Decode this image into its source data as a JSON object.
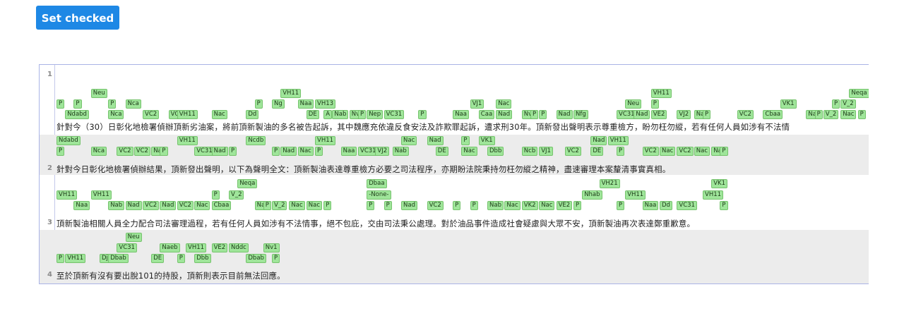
{
  "toolbar": {
    "set_checked_label": "Set checked"
  },
  "editor": {
    "lines": [
      {
        "number": "1",
        "text": "針對今（30）日彰化地檢署偵辦頂新劣油案，將前頂新製油的多名被告起訴，其中魏應充依違反食安法及詐欺罪起訴，遭求刑30年。頂新發出聲明表示尊重檢方，盼勿枉勿縱，若有任何人員如涉有不法情",
        "tags": [
          {
            "t": "Neu",
            "r": 0,
            "c": 4
          },
          {
            "t": "VH11",
            "r": 0,
            "c": 26
          },
          {
            "t": "VH11",
            "r": 0,
            "c": 69
          },
          {
            "t": "Neqa",
            "r": 0,
            "c": 92
          },
          {
            "t": "P",
            "r": 1,
            "c": 0
          },
          {
            "t": "P",
            "r": 1,
            "c": 2
          },
          {
            "t": "P",
            "r": 1,
            "c": 6
          },
          {
            "t": "Nca",
            "r": 1,
            "c": 8
          },
          {
            "t": "P",
            "r": 1,
            "c": 23
          },
          {
            "t": "Ng",
            "r": 1,
            "c": 25
          },
          {
            "t": "Naa",
            "r": 1,
            "c": 28
          },
          {
            "t": "VH13",
            "r": 1,
            "c": 30
          },
          {
            "t": "VJ1",
            "r": 1,
            "c": 48
          },
          {
            "t": "Nac",
            "r": 1,
            "c": 51
          },
          {
            "t": "Neu",
            "r": 1,
            "c": 66
          },
          {
            "t": "P",
            "r": 1,
            "c": 69
          },
          {
            "t": "VK1",
            "r": 1,
            "c": 84
          },
          {
            "t": "P",
            "r": 1,
            "c": 90
          },
          {
            "t": "V_2",
            "r": 1,
            "c": 91
          },
          {
            "t": "Ndabd",
            "r": 2,
            "c": 1
          },
          {
            "t": "Nca",
            "r": 2,
            "c": 6
          },
          {
            "t": "VC2",
            "r": 2,
            "c": 10
          },
          {
            "t": "VC2",
            "r": 2,
            "c": 13
          },
          {
            "t": "VH11",
            "r": 2,
            "c": 14
          },
          {
            "t": "Nac",
            "r": 2,
            "c": 18
          },
          {
            "t": "Dd",
            "r": 2,
            "c": 22
          },
          {
            "t": "DE",
            "r": 2,
            "c": 29
          },
          {
            "t": "A",
            "r": 2,
            "c": 31
          },
          {
            "t": "Nab",
            "r": 2,
            "c": 32
          },
          {
            "t": "Nv1",
            "r": 2,
            "c": 34
          },
          {
            "t": "P",
            "r": 2,
            "c": 35
          },
          {
            "t": "Nep",
            "r": 2,
            "c": 36
          },
          {
            "t": "VC31",
            "r": 2,
            "c": 38
          },
          {
            "t": "P",
            "r": 2,
            "c": 42
          },
          {
            "t": "Naa",
            "r": 2,
            "c": 46
          },
          {
            "t": "Caa",
            "r": 2,
            "c": 49
          },
          {
            "t": "Nad",
            "r": 2,
            "c": 51
          },
          {
            "t": "Nv1",
            "r": 2,
            "c": 54
          },
          {
            "t": "P",
            "r": 2,
            "c": 55
          },
          {
            "t": "P",
            "r": 2,
            "c": 56
          },
          {
            "t": "Nad",
            "r": 2,
            "c": 58
          },
          {
            "t": "Nfg",
            "r": 2,
            "c": 60
          },
          {
            "t": "VC31",
            "r": 2,
            "c": 65
          },
          {
            "t": "Nad",
            "r": 2,
            "c": 67
          },
          {
            "t": "VE2",
            "r": 2,
            "c": 69
          },
          {
            "t": "VJ2",
            "r": 2,
            "c": 72
          },
          {
            "t": "Nab",
            "r": 2,
            "c": 74
          },
          {
            "t": "P",
            "r": 2,
            "c": 75
          },
          {
            "t": "VC2",
            "r": 2,
            "c": 79
          },
          {
            "t": "Cbaa",
            "r": 2,
            "c": 82
          },
          {
            "t": "Nab",
            "r": 2,
            "c": 87
          },
          {
            "t": "P",
            "r": 2,
            "c": 88
          },
          {
            "t": "V_2",
            "r": 2,
            "c": 89
          },
          {
            "t": "Nac",
            "r": 2,
            "c": 91
          },
          {
            "t": "P",
            "r": 2,
            "c": 93
          }
        ]
      },
      {
        "number": "2",
        "text": "針對今日彰化地檢署偵辦結果，頂新發出聲明，以下為聲明全文：頂新製油表達尊重檢方必要之司法程序，亦期盼法院秉持勿枉勿縱之精神，盡速審理本案釐清事實真相。",
        "tags": [
          {
            "t": "Ndabd",
            "r": 0,
            "c": 0
          },
          {
            "t": "VH11",
            "r": 0,
            "c": 14
          },
          {
            "t": "Ncdb",
            "r": 0,
            "c": 22
          },
          {
            "t": "VH11",
            "r": 0,
            "c": 30
          },
          {
            "t": "Nac",
            "r": 0,
            "c": 40
          },
          {
            "t": "Nad",
            "r": 0,
            "c": 43
          },
          {
            "t": "P",
            "r": 0,
            "c": 47
          },
          {
            "t": "VK1",
            "r": 0,
            "c": 49
          },
          {
            "t": "Nad",
            "r": 0,
            "c": 62
          },
          {
            "t": "VH11",
            "r": 0,
            "c": 64
          },
          {
            "t": "P",
            "r": 1,
            "c": 0
          },
          {
            "t": "Nca",
            "r": 1,
            "c": 4
          },
          {
            "t": "VC2",
            "r": 1,
            "c": 7
          },
          {
            "t": "VC2",
            "r": 1,
            "c": 9
          },
          {
            "t": "Nac",
            "r": 1,
            "c": 11
          },
          {
            "t": "P",
            "r": 1,
            "c": 12
          },
          {
            "t": "VC31",
            "r": 1,
            "c": 16
          },
          {
            "t": "Nad",
            "r": 1,
            "c": 18
          },
          {
            "t": "P",
            "r": 1,
            "c": 20
          },
          {
            "t": "P",
            "r": 1,
            "c": 25
          },
          {
            "t": "Nad",
            "r": 1,
            "c": 26
          },
          {
            "t": "Nac",
            "r": 1,
            "c": 28
          },
          {
            "t": "P",
            "r": 1,
            "c": 30
          },
          {
            "t": "Naa",
            "r": 1,
            "c": 33
          },
          {
            "t": "VC31",
            "r": 1,
            "c": 35
          },
          {
            "t": "VJ2",
            "r": 1,
            "c": 37
          },
          {
            "t": "Nab",
            "r": 1,
            "c": 39
          },
          {
            "t": "DE",
            "r": 1,
            "c": 44
          },
          {
            "t": "Nac",
            "r": 1,
            "c": 47
          },
          {
            "t": "Dbb",
            "r": 1,
            "c": 50
          },
          {
            "t": "Ncb",
            "r": 1,
            "c": 54
          },
          {
            "t": "VJ1",
            "r": 1,
            "c": 56
          },
          {
            "t": "VC2",
            "r": 1,
            "c": 59
          },
          {
            "t": "DE",
            "r": 1,
            "c": 62
          },
          {
            "t": "P",
            "r": 1,
            "c": 65
          },
          {
            "t": "VC2",
            "r": 1,
            "c": 68
          },
          {
            "t": "Nac",
            "r": 1,
            "c": 70
          },
          {
            "t": "VC2",
            "r": 1,
            "c": 72
          },
          {
            "t": "Nac",
            "r": 1,
            "c": 74
          },
          {
            "t": "Nac",
            "r": 1,
            "c": 76
          },
          {
            "t": "P",
            "r": 1,
            "c": 77
          }
        ]
      },
      {
        "number": "3",
        "text": "頂新製油相關人員全力配合司法審理過程，若有任何人員如涉有不法情事，絕不包庇，交由司法秉公處理。對於油品事件造成社會疑慮與大眾不安，頂新製油再次表達鄭重歉意。",
        "tags": [
          {
            "t": "Neqa",
            "r": 0,
            "c": 21
          },
          {
            "t": "Dbaa",
            "r": 0,
            "c": 36
          },
          {
            "t": "VH21",
            "r": 0,
            "c": 63
          },
          {
            "t": "VK1",
            "r": 0,
            "c": 76
          },
          {
            "t": "VH11",
            "r": 1,
            "c": 0
          },
          {
            "t": "VH11",
            "r": 1,
            "c": 4
          },
          {
            "t": "P",
            "r": 1,
            "c": 18
          },
          {
            "t": "V_2",
            "r": 1,
            "c": 20
          },
          {
            "t": "-None-",
            "r": 1,
            "c": 36
          },
          {
            "t": "Nhab",
            "r": 1,
            "c": 61
          },
          {
            "t": "VH11",
            "r": 1,
            "c": 66
          },
          {
            "t": "VH11",
            "r": 1,
            "c": 75
          },
          {
            "t": "Naa",
            "r": 2,
            "c": 2
          },
          {
            "t": "Nab",
            "r": 2,
            "c": 6
          },
          {
            "t": "Nad",
            "r": 2,
            "c": 8
          },
          {
            "t": "VC2",
            "r": 2,
            "c": 10
          },
          {
            "t": "Nad",
            "r": 2,
            "c": 12
          },
          {
            "t": "VC2",
            "r": 2,
            "c": 14
          },
          {
            "t": "Nac",
            "r": 2,
            "c": 16
          },
          {
            "t": "Cbaa",
            "r": 2,
            "c": 18
          },
          {
            "t": "Nab",
            "r": 2,
            "c": 23
          },
          {
            "t": "P",
            "r": 2,
            "c": 24
          },
          {
            "t": "V_2",
            "r": 2,
            "c": 25
          },
          {
            "t": "Nac",
            "r": 2,
            "c": 27
          },
          {
            "t": "Nac",
            "r": 2,
            "c": 29
          },
          {
            "t": "P",
            "r": 2,
            "c": 31
          },
          {
            "t": "P",
            "r": 2,
            "c": 36
          },
          {
            "t": "P",
            "r": 2,
            "c": 38
          },
          {
            "t": "Nad",
            "r": 2,
            "c": 40
          },
          {
            "t": "VC2",
            "r": 2,
            "c": 43
          },
          {
            "t": "P",
            "r": 2,
            "c": 46
          },
          {
            "t": "P",
            "r": 2,
            "c": 48
          },
          {
            "t": "Nab",
            "r": 2,
            "c": 50
          },
          {
            "t": "Nac",
            "r": 2,
            "c": 52
          },
          {
            "t": "VK2",
            "r": 2,
            "c": 54
          },
          {
            "t": "Nac",
            "r": 2,
            "c": 56
          },
          {
            "t": "VE2",
            "r": 2,
            "c": 58
          },
          {
            "t": "P",
            "r": 2,
            "c": 60
          },
          {
            "t": "P",
            "r": 2,
            "c": 65
          },
          {
            "t": "Naa",
            "r": 2,
            "c": 68
          },
          {
            "t": "Dd",
            "r": 2,
            "c": 70
          },
          {
            "t": "VC31",
            "r": 2,
            "c": 72
          },
          {
            "t": "P",
            "r": 2,
            "c": 77
          }
        ]
      },
      {
        "number": "4",
        "text": "至於頂新有沒有要出脫101的持股，頂新則表示目前無法回應。",
        "tags": [
          {
            "t": "Neu",
            "r": 0,
            "c": 8
          },
          {
            "t": "VC31",
            "r": 1,
            "c": 7
          },
          {
            "t": "Naeb",
            "r": 1,
            "c": 12
          },
          {
            "t": "VH11",
            "r": 1,
            "c": 15
          },
          {
            "t": "VE2",
            "r": 1,
            "c": 18
          },
          {
            "t": "Nddc",
            "r": 1,
            "c": 20
          },
          {
            "t": "Nv1",
            "r": 1,
            "c": 24
          },
          {
            "t": "P",
            "r": 2,
            "c": 0
          },
          {
            "t": "VH11",
            "r": 2,
            "c": 1
          },
          {
            "t": "Dj",
            "r": 2,
            "c": 5
          },
          {
            "t": "Dbab",
            "r": 2,
            "c": 6
          },
          {
            "t": "DE",
            "r": 2,
            "c": 11
          },
          {
            "t": "P",
            "r": 2,
            "c": 14
          },
          {
            "t": "Dbb",
            "r": 2,
            "c": 16
          },
          {
            "t": "Dbab",
            "r": 2,
            "c": 22
          },
          {
            "t": "P",
            "r": 2,
            "c": 25
          }
        ]
      }
    ]
  }
}
